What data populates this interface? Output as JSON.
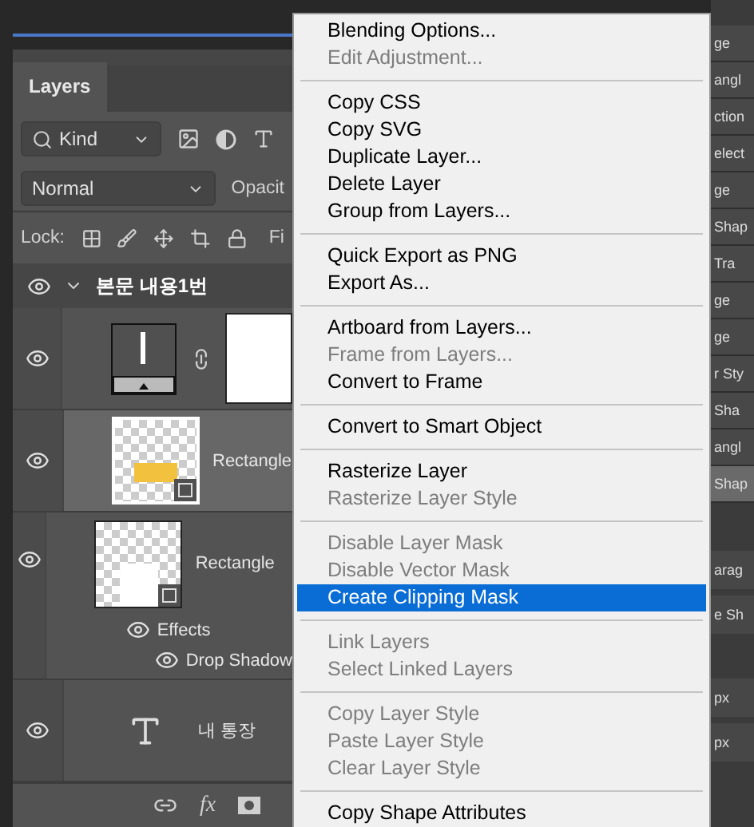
{
  "panel": {
    "tab": "Layers",
    "filter": "Kind",
    "blend_mode": "Normal",
    "opacity_label": "Opacit",
    "lock_label": "Lock:",
    "fill_label": "Fi"
  },
  "group": {
    "name": "본문 내용1번",
    "expanded": true
  },
  "layers": [
    {
      "kind": "symbol",
      "selected": false,
      "linked_mask": true
    },
    {
      "kind": "shape",
      "name": "Rectangle",
      "selected": true
    },
    {
      "kind": "rounded-shape",
      "name": "Rectangle",
      "selected": false,
      "effects": "Effects",
      "effect": "Drop Shadow"
    },
    {
      "kind": "type",
      "name": "내 통장",
      "selected": false
    }
  ],
  "footer": {
    "fx": "fx"
  },
  "menu": [
    [
      {
        "label": "Blending Options...",
        "disabled": false,
        "selected": false
      },
      {
        "label": "Edit Adjustment...",
        "disabled": true,
        "selected": false
      }
    ],
    [
      {
        "label": "Copy CSS",
        "disabled": false,
        "selected": false
      },
      {
        "label": "Copy SVG",
        "disabled": false,
        "selected": false
      },
      {
        "label": "Duplicate Layer...",
        "disabled": false,
        "selected": false
      },
      {
        "label": "Delete Layer",
        "disabled": false,
        "selected": false
      },
      {
        "label": "Group from Layers...",
        "disabled": false,
        "selected": false
      }
    ],
    [
      {
        "label": "Quick Export as PNG",
        "disabled": false,
        "selected": false
      },
      {
        "label": "Export As...",
        "disabled": false,
        "selected": false
      }
    ],
    [
      {
        "label": "Artboard from Layers...",
        "disabled": false,
        "selected": false
      },
      {
        "label": "Frame from Layers...",
        "disabled": true,
        "selected": false
      },
      {
        "label": "Convert to Frame",
        "disabled": false,
        "selected": false
      }
    ],
    [
      {
        "label": "Convert to Smart Object",
        "disabled": false,
        "selected": false
      }
    ],
    [
      {
        "label": "Rasterize Layer",
        "disabled": false,
        "selected": false
      },
      {
        "label": "Rasterize Layer Style",
        "disabled": true,
        "selected": false
      }
    ],
    [
      {
        "label": "Disable Layer Mask",
        "disabled": true,
        "selected": false
      },
      {
        "label": "Disable Vector Mask",
        "disabled": true,
        "selected": false
      },
      {
        "label": "Create Clipping Mask",
        "disabled": false,
        "selected": true
      }
    ],
    [
      {
        "label": "Link Layers",
        "disabled": true,
        "selected": false
      },
      {
        "label": "Select Linked Layers",
        "disabled": true,
        "selected": false
      }
    ],
    [
      {
        "label": "Copy Layer Style",
        "disabled": true,
        "selected": false
      },
      {
        "label": "Paste Layer Style",
        "disabled": true,
        "selected": false
      },
      {
        "label": "Clear Layer Style",
        "disabled": true,
        "selected": false
      }
    ],
    [
      {
        "label": "Copy Shape Attributes",
        "disabled": false,
        "selected": false
      }
    ]
  ],
  "side_items": [
    {
      "label": "ge",
      "selected": false
    },
    {
      "label": "angl",
      "selected": false
    },
    {
      "label": "ction",
      "selected": false
    },
    {
      "label": "elect",
      "selected": false
    },
    {
      "label": "ge",
      "selected": false
    },
    {
      "label": "Shap",
      "selected": false
    },
    {
      "label": "Tra",
      "selected": false
    },
    {
      "label": "ge",
      "selected": false
    },
    {
      "label": "ge",
      "selected": false
    },
    {
      "label": "r Sty",
      "selected": false
    },
    {
      "label": "Sha",
      "selected": false
    },
    {
      "label": "angl",
      "selected": false
    },
    {
      "label": "Shap",
      "selected": true
    }
  ],
  "side_lower": [
    "arag",
    "e Sh",
    "px",
    "px"
  ]
}
